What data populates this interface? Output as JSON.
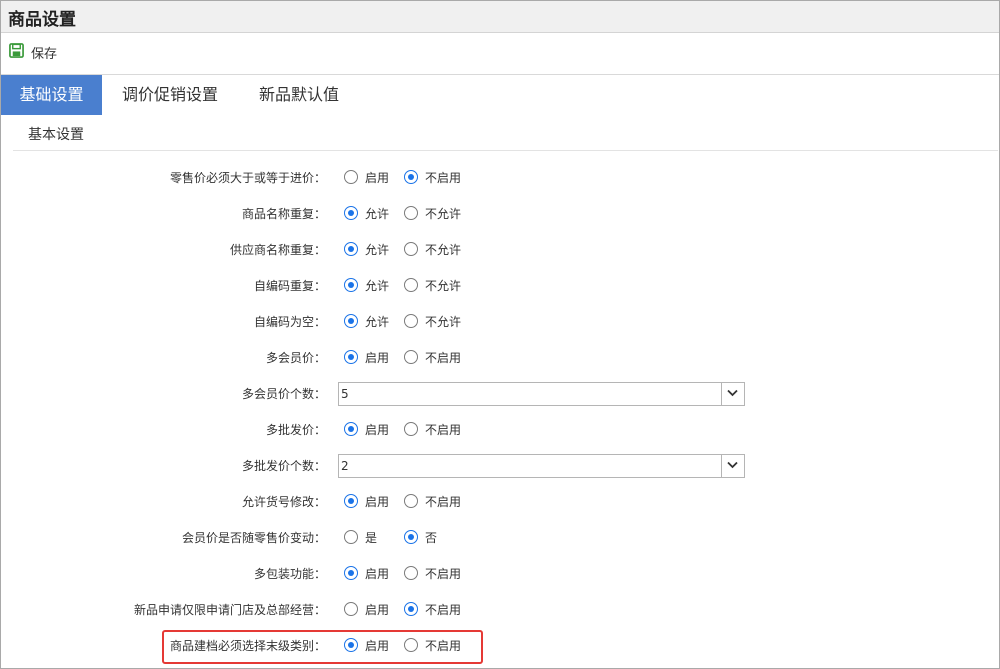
{
  "window": {
    "title": "商品设置"
  },
  "toolbar": {
    "save_label": "保存"
  },
  "tabs": [
    {
      "label": "基础设置",
      "active": true
    },
    {
      "label": "调价促销设置",
      "active": false
    },
    {
      "label": "新品默认值",
      "active": false
    }
  ],
  "section": {
    "title": "基本设置"
  },
  "settings": [
    {
      "label": "零售价必须大于或等于进价：",
      "type": "radio",
      "options": [
        "启用",
        "不启用"
      ],
      "selected": 1
    },
    {
      "label": "商品名称重复：",
      "type": "radio",
      "options": [
        "允许",
        "不允许"
      ],
      "selected": 0
    },
    {
      "label": "供应商名称重复：",
      "type": "radio",
      "options": [
        "允许",
        "不允许"
      ],
      "selected": 0
    },
    {
      "label": "自编码重复：",
      "type": "radio",
      "options": [
        "允许",
        "不允许"
      ],
      "selected": 0
    },
    {
      "label": "自编码为空：",
      "type": "radio",
      "options": [
        "允许",
        "不允许"
      ],
      "selected": 0
    },
    {
      "label": "多会员价：",
      "type": "radio",
      "options": [
        "启用",
        "不启用"
      ],
      "selected": 0
    },
    {
      "label": "多会员价个数：",
      "type": "select",
      "value": "5"
    },
    {
      "label": "多批发价：",
      "type": "radio",
      "options": [
        "启用",
        "不启用"
      ],
      "selected": 0
    },
    {
      "label": "多批发价个数：",
      "type": "select",
      "value": "2"
    },
    {
      "label": "允许货号修改：",
      "type": "radio",
      "options": [
        "启用",
        "不启用"
      ],
      "selected": 0
    },
    {
      "label": "会员价是否随零售价变动：",
      "type": "radio",
      "options": [
        "是",
        "否"
      ],
      "selected": 1
    },
    {
      "label": "多包装功能：",
      "type": "radio",
      "options": [
        "启用",
        "不启用"
      ],
      "selected": 0
    },
    {
      "label": "新品申请仅限申请门店及总部经营：",
      "type": "radio",
      "options": [
        "启用",
        "不启用"
      ],
      "selected": 1
    },
    {
      "label": "商品建档必须选择末级类别：",
      "type": "radio",
      "options": [
        "启用",
        "不启用"
      ],
      "selected": 0
    }
  ],
  "colors": {
    "accent": "#4a7fcf",
    "radio": "#1a73e8",
    "highlight": "#e53935"
  }
}
